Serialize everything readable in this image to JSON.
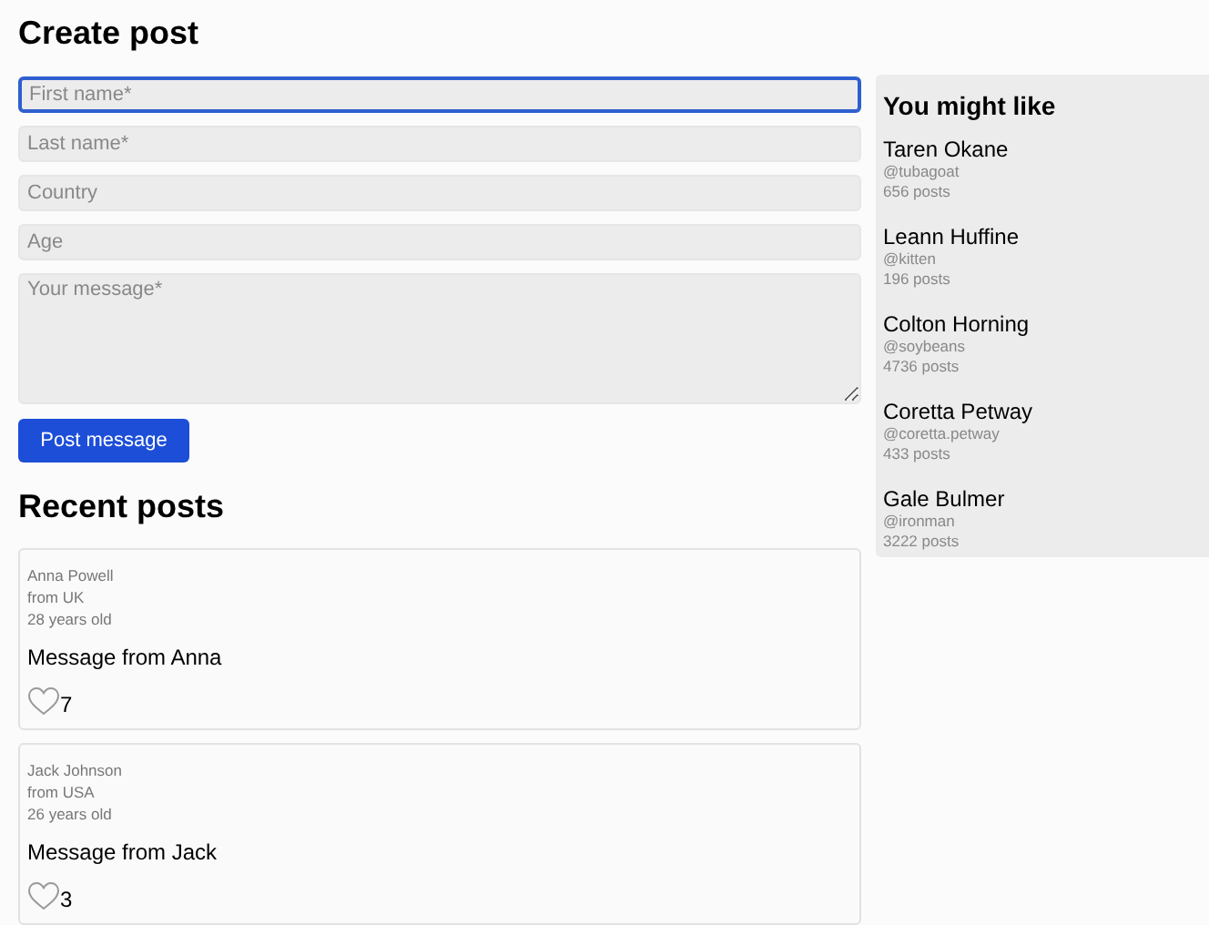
{
  "create_post": {
    "title": "Create post",
    "fields": [
      {
        "kind": "input",
        "placeholder": "First name*",
        "focused": true
      },
      {
        "kind": "input",
        "placeholder": "Last name*",
        "focused": false
      },
      {
        "kind": "input",
        "placeholder": "Country",
        "focused": false
      },
      {
        "kind": "input",
        "placeholder": "Age",
        "focused": false
      },
      {
        "kind": "textarea",
        "placeholder": "Your message*",
        "focused": false
      }
    ],
    "submit": "Post message"
  },
  "recent_posts": {
    "title": "Recent posts",
    "posts": [
      {
        "author": "Anna Powell",
        "country": "from UK",
        "age": "28 years old",
        "message": "Message from Anna",
        "likes": "7"
      },
      {
        "author": "Jack Johnson",
        "country": "from USA",
        "age": "26 years old",
        "message": "Message from Jack",
        "likes": "3"
      }
    ]
  },
  "sidebar": {
    "title": "You might like",
    "users": [
      {
        "name": "Taren Okane",
        "handle": "@tubagoat",
        "posts": "656 posts"
      },
      {
        "name": "Leann Huffine",
        "handle": "@kitten",
        "posts": "196 posts"
      },
      {
        "name": "Colton Horning",
        "handle": "@soybeans",
        "posts": "4736 posts"
      },
      {
        "name": "Coretta Petway",
        "handle": "@coretta.petway",
        "posts": "433 posts"
      },
      {
        "name": "Gale Bulmer",
        "handle": "@ironman",
        "posts": "3222 posts"
      }
    ]
  }
}
